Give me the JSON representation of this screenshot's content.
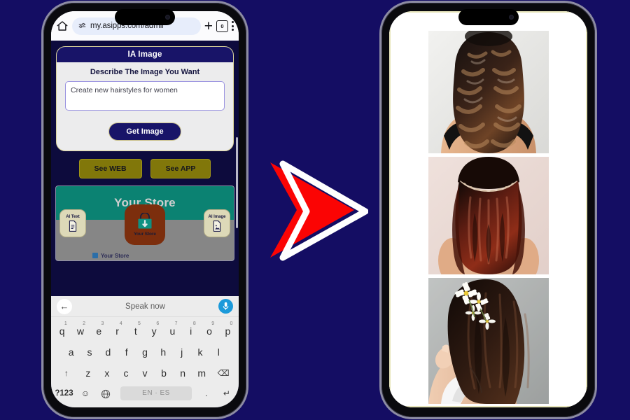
{
  "page": {
    "background_color": "#140d63",
    "accent_red": "#fb0404",
    "arrow_outline": "#ffffff"
  },
  "left_phone": {
    "browser": {
      "home_icon": "home-icon",
      "url": "my.asipps.com/admir",
      "lock_icon": "page-settings-icon",
      "new_tab_icon": "plus-icon",
      "tab_count": "0",
      "menu_icon": "three-dots-icon"
    },
    "ia_card": {
      "header": "IA Image",
      "label": "Describe The Image You Want",
      "prompt_value": "Create new hairstyles for women",
      "prompt_placeholder": "Describe The Image You Want",
      "submit_label": "Get Image"
    },
    "links": {
      "see_web": "See WEB",
      "see_app": "See APP"
    },
    "store_panel": {
      "title": "Your Store",
      "left_card_label": "AI Text",
      "left_card_icon": "document-icon",
      "right_card_label": "AI Image",
      "right_card_icon": "image-file-icon",
      "app_icon_label": "Your Store",
      "app_icon_glyph": "shopping-bag-icon",
      "footer_label": "Your Store"
    },
    "voice_bar": {
      "back_icon": "back-arrow-icon",
      "status_text": "Speak now",
      "mic_icon": "microphone-icon"
    },
    "keyboard": {
      "row1": [
        {
          "key": "q",
          "sup": "1"
        },
        {
          "key": "w",
          "sup": "2"
        },
        {
          "key": "e",
          "sup": "3"
        },
        {
          "key": "r",
          "sup": "4"
        },
        {
          "key": "t",
          "sup": "5"
        },
        {
          "key": "y",
          "sup": "6"
        },
        {
          "key": "u",
          "sup": "7"
        },
        {
          "key": "i",
          "sup": "8"
        },
        {
          "key": "o",
          "sup": "9"
        },
        {
          "key": "p",
          "sup": "0"
        }
      ],
      "row2": [
        "a",
        "s",
        "d",
        "f",
        "g",
        "h",
        "j",
        "k",
        "l"
      ],
      "row3": {
        "shift": "↑",
        "letters": [
          "z",
          "x",
          "c",
          "v",
          "b",
          "n",
          "m"
        ],
        "backspace": "⌫"
      },
      "row4": {
        "numeric": "?123",
        "emoji": "☺",
        "language_icon": "globe-icon",
        "space_label": "EN · ES",
        "period": ".",
        "enter": "↵"
      }
    }
  },
  "right_phone": {
    "results": [
      {
        "name": "hairstyle-result-1",
        "description": "Long dark brown wavy curled hair viewed from behind, light grey studio background",
        "alt": "Wavy curled dark hair back view"
      },
      {
        "name": "hairstyle-result-2",
        "description": "Long auburn red straight hair with braided halo headband, pale pink background",
        "alt": "Auburn hair with braid crown"
      },
      {
        "name": "hairstyle-result-3",
        "description": "Dark brown long hair with white daisy flowers tucked in, woman in white top, grey background",
        "alt": "Hair with white daisies"
      }
    ]
  }
}
